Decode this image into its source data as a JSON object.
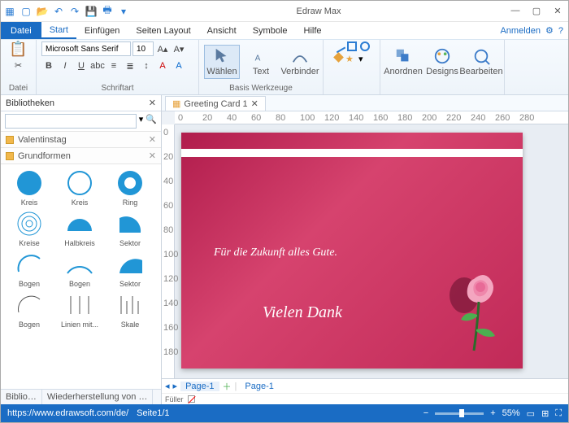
{
  "app_title": "Edraw Max",
  "file_tab": "Datei",
  "menu_tabs": [
    "Start",
    "Einfügen",
    "Seiten Layout",
    "Ansicht",
    "Symbole",
    "Hilfe"
  ],
  "active_menu": 0,
  "anmelden": "Anmelden",
  "ribbon": {
    "datei_label": "Datei",
    "font_name": "Microsoft Sans Serif",
    "font_size": "10",
    "schriftart_label": "Schriftart",
    "wahlen": "Wählen",
    "text": "Text",
    "verbinder": "Verbinder",
    "basis_label": "Basis Werkzeuge",
    "anordnen": "Anordnen",
    "designs": "Designs",
    "bearbeiten": "Bearbeiten"
  },
  "lib": {
    "title": "Bibliotheken",
    "cat1": "Valentinstag",
    "cat2": "Grundformen",
    "shapes": [
      "Kreis",
      "Kreis",
      "Ring",
      "Kreise",
      "Halbkreis",
      "Sektor",
      "Bogen",
      "Bogen",
      "Sektor",
      "Bogen",
      "Linien mit...",
      "Skale"
    ],
    "tab1": "Biblio…",
    "tab2": "Wiederherstellung von …"
  },
  "doc_tab": "Greeting Card 1",
  "ruler_h": [
    "0",
    "20",
    "40",
    "60",
    "80",
    "100",
    "120",
    "140",
    "160",
    "180",
    "200",
    "220",
    "240",
    "260",
    "280"
  ],
  "ruler_v": [
    "0",
    "20",
    "40",
    "60",
    "80",
    "100",
    "120",
    "140",
    "160",
    "180"
  ],
  "card": {
    "line1": "Für die Zukunft alles Gute.",
    "line2": "Vielen Dank"
  },
  "page_tabs": {
    "fuller": "Füller",
    "p1": "Page-1",
    "p2": "Page-1"
  },
  "status": {
    "url": "https://www.edrawsoft.com/de/",
    "page": "Seite1/1",
    "zoom": "55%"
  },
  "colors": [
    "#000",
    "#333",
    "#555",
    "#777",
    "#999",
    "#bbb",
    "#ddd",
    "#fff",
    "#400",
    "#600",
    "#800",
    "#a00",
    "#c00",
    "#e00",
    "#f44",
    "#f88",
    "#220044",
    "#440066",
    "#660088",
    "#8800aa",
    "#aa00cc",
    "#cc00ee",
    "#e066ff",
    "#f0aaff",
    "#002244",
    "#003366",
    "#004488",
    "#0055aa",
    "#0066cc",
    "#3399ff",
    "#66bbff",
    "#aaddff",
    "#004400",
    "#006600",
    "#008800",
    "#00aa00",
    "#00cc00",
    "#33dd33",
    "#77ee77",
    "#bbffbb",
    "#444400",
    "#666600",
    "#888800",
    "#aaaa00",
    "#cccc00",
    "#eeee33",
    "#ffff77",
    "#ffffbb",
    "#442200",
    "#663300",
    "#884400",
    "#aa5500",
    "#cc7700",
    "#ee9933",
    "#ffbb77",
    "#ffddbb"
  ]
}
